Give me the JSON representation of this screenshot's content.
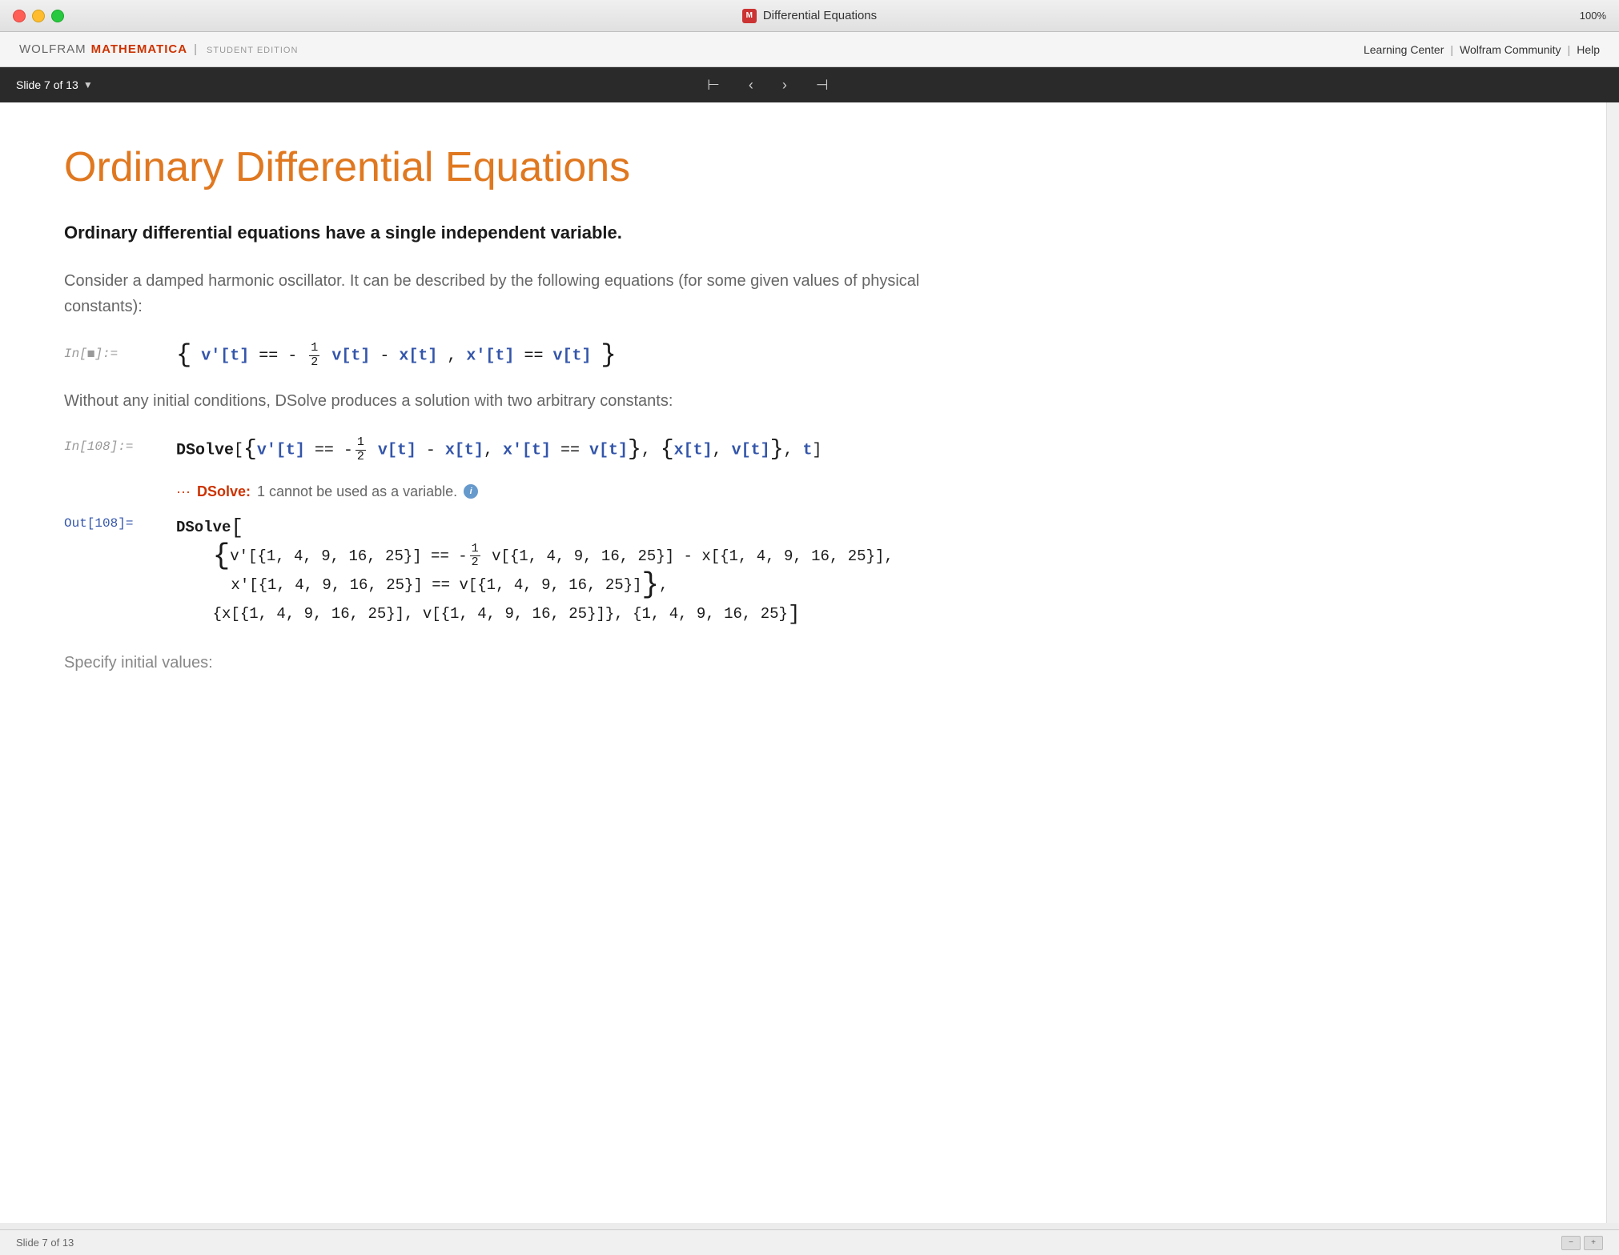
{
  "window": {
    "title": "Differential Equations",
    "zoom": "100%"
  },
  "menubar": {
    "wolfram": "WOLFRAM",
    "mathematica": "MATHEMATICA",
    "edition": "STUDENT EDITION",
    "links": [
      "Learning Center",
      "Wolfram Community",
      "Help"
    ]
  },
  "navbar": {
    "slide_indicator": "Slide 7 of 13",
    "nav_first": "⊢",
    "nav_prev": "‹",
    "nav_next": "›",
    "nav_last": "⊣"
  },
  "slide": {
    "title": "Ordinary Differential Equations",
    "subtitle": "Ordinary differential equations have a single independent variable.",
    "body1": "Consider a damped harmonic oscillator. It can be described by the following equations (for some given values of physical constants):",
    "in_label1": "In[◼]:=",
    "in_label2": "In[108]:=",
    "out_label": "Out[108]=",
    "message": "DSolve: 1 cannot be used as a variable.",
    "specify_text": "Specify initial values:"
  },
  "bottom_bar": {
    "label": "Slide 7 of 13"
  }
}
